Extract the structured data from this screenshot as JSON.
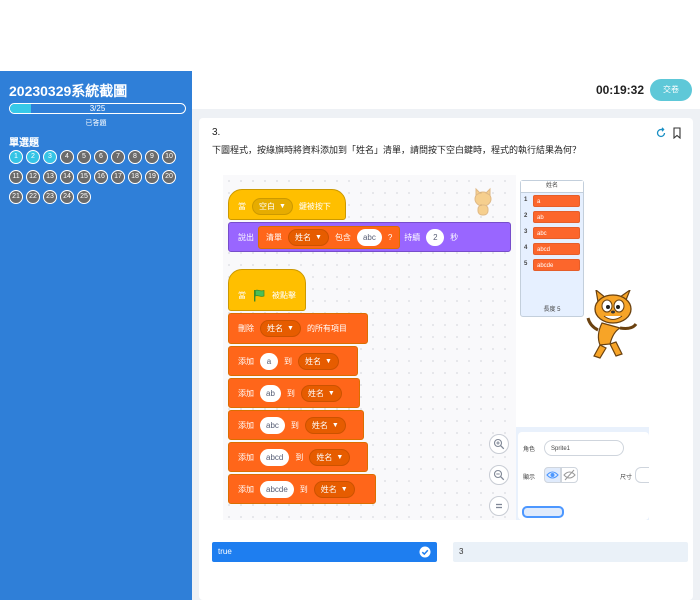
{
  "sidebar": {
    "title": "20230329系統截圖",
    "progress_text": "3/25",
    "progress_fraction": 0.12,
    "answered_label": "已答題",
    "section_label": "單選題",
    "questions": [
      "1",
      "2",
      "3",
      "4",
      "5",
      "6",
      "7",
      "8",
      "9",
      "10",
      "11",
      "12",
      "13",
      "14",
      "15",
      "16",
      "17",
      "18",
      "19",
      "20",
      "21",
      "22",
      "23",
      "24",
      "25"
    ],
    "answered": [
      1,
      2,
      3
    ]
  },
  "topbar": {
    "timer": "00:19:32",
    "submit_label": "交卷"
  },
  "question": {
    "number": "3.",
    "text": "下圖程式，按綠旗時將資料添加到「姓名」清單，請問按下空白鍵時，程式的執行結果為何？",
    "icons": [
      "refresh-icon",
      "bookmark-icon"
    ]
  },
  "scratch": {
    "key_hat": {
      "when": "當",
      "key": "空白",
      "pressed": "鍵被按下"
    },
    "say_block": {
      "say": "說出",
      "list": "清單",
      "list_name": "姓名",
      "contains": "包含",
      "item": "abc",
      "q": "?",
      "for": "持續",
      "secs": "2",
      "unit": "秒"
    },
    "flag_hat": {
      "when": "當",
      "clicked": "被點擊"
    },
    "delete_block": {
      "delete": "刪除",
      "list_name": "姓名",
      "all": "的所有項目"
    },
    "add_blocks": [
      {
        "add": "添加",
        "value": "a",
        "to": "到",
        "list_name": "姓名"
      },
      {
        "add": "添加",
        "value": "ab",
        "to": "到",
        "list_name": "姓名"
      },
      {
        "add": "添加",
        "value": "abc",
        "to": "到",
        "list_name": "姓名"
      },
      {
        "add": "添加",
        "value": "abcd",
        "to": "到",
        "list_name": "姓名"
      },
      {
        "add": "添加",
        "value": "abcde",
        "to": "到",
        "list_name": "姓名"
      }
    ],
    "list_monitor": {
      "title": "姓名",
      "items": [
        {
          "index": "1",
          "value": "a"
        },
        {
          "index": "2",
          "value": "ab"
        },
        {
          "index": "3",
          "value": "abc"
        },
        {
          "index": "4",
          "value": "abcd"
        },
        {
          "index": "5",
          "value": "abcde"
        }
      ],
      "length_label": "長度 5"
    },
    "sprite_panel": {
      "sprite_label": "角色",
      "sprite_name": "Sprite1",
      "show_label": "顯示",
      "size_label": "尺寸"
    }
  },
  "options": [
    {
      "label": "true",
      "selected": true
    },
    {
      "label": "3",
      "selected": false
    }
  ],
  "colors": {
    "sidebar": "#2f7fd8",
    "answered": "#35c4e6",
    "unanswered": "#6b6b6b",
    "selected_option": "#1e7ef0",
    "events": "#ffbf00",
    "looks": "#9966ff",
    "variables": "#ff661a"
  }
}
